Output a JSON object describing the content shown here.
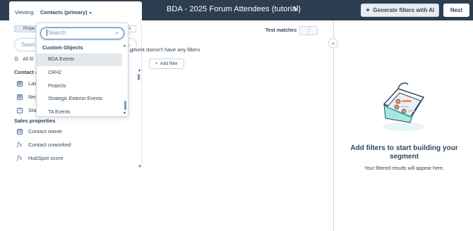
{
  "topbar": {
    "title": "BDA - 2025 Forum Attendees (tutorial)",
    "ai_button": "Generate filters with AI",
    "next_button": "Next"
  },
  "viewing": {
    "label": "Viewing:",
    "value": "Contacts (primary)"
  },
  "left": {
    "tab_prop": "Prope",
    "tab_right": "s",
    "search_placeholder": "Searc",
    "all_filters": "All fil",
    "group_1": "Contact a",
    "items_1": [
      "Las",
      "Nex",
      "Sta"
    ],
    "group_2": "Sales properties",
    "items_2": [
      "Contact owner",
      "Contact unworked",
      "HubSpot score"
    ]
  },
  "canvas": {
    "segment_msg": "gment doesn't have any filters",
    "add_filter": "Add filter",
    "test_matches": "Test matches"
  },
  "dropdown": {
    "search_placeholder": "Search",
    "group": "Custom Objects",
    "items": [
      "BDA Events",
      "CRH2",
      "Projects",
      "Strategic Exterior Events",
      "TA Events"
    ],
    "selected_index": 0
  },
  "empty_state": {
    "title": "Add filters to start building your segment",
    "subtitle": "Your filtered results will appear here."
  },
  "colors": {
    "topbar": "#2d3e50",
    "text": "#33475b",
    "focus": "#4a7cc9"
  }
}
